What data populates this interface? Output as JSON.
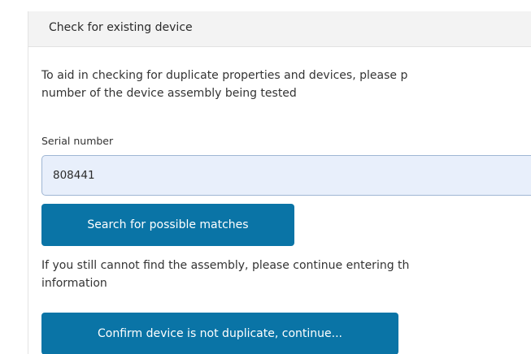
{
  "panel": {
    "title": "Check for existing device",
    "intro_line1": "To aid in checking for duplicate properties and devices, please p",
    "intro_line2": "number of the device assembly being tested",
    "serial_label": "Serial number",
    "serial_value": "808441",
    "search_button": "Search for possible matches",
    "after_line1": "If you still cannot find the assembly, please continue entering th",
    "after_line2": "information",
    "confirm_button": "Confirm device is not duplicate, continue..."
  },
  "colors": {
    "button": "#0a74a6",
    "input_bg": "#e8effb",
    "header_bg": "#f3f3f3"
  }
}
